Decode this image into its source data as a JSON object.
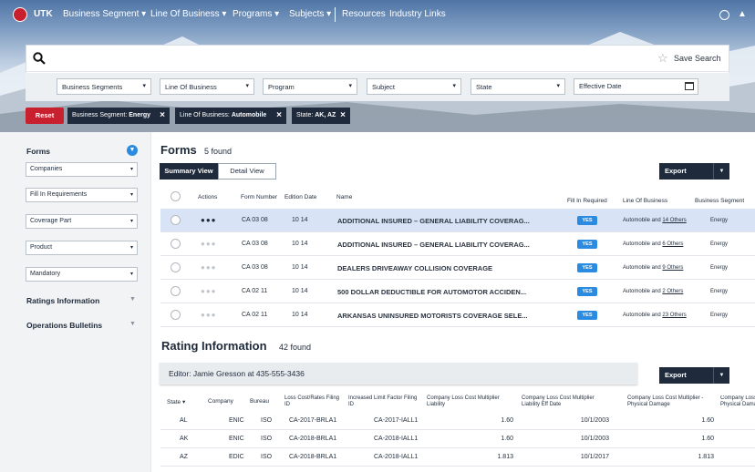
{
  "nav": {
    "brand": "UTK",
    "items": [
      "Business Segment",
      "Line Of Business",
      "Programs",
      "Subjects",
      "Resources",
      "Industry Links"
    ]
  },
  "search": {
    "placeholder": "",
    "save_label": "Save Search"
  },
  "filters": {
    "selects": [
      "Business Segments",
      "Line Of Business",
      "Program",
      "Subject",
      "State"
    ],
    "date_label": "Effective Date"
  },
  "active_filters": {
    "reset_label": "Reset",
    "chips": [
      {
        "label": "Business Segment: ",
        "value": "Energy"
      },
      {
        "label": "Line Of Business: ",
        "value": "Automobile"
      },
      {
        "label": "State: ",
        "value": "AK, AZ"
      }
    ]
  },
  "sidebar": {
    "forms_title": "Forms",
    "selects": [
      "Companies",
      "Fill In Requirements",
      "Coverage Part",
      "Product",
      "Mandatory"
    ],
    "sections": [
      "Ratings Information",
      "Operations Bulletins"
    ]
  },
  "forms": {
    "title": "Forms",
    "count": "5 found",
    "tabs": [
      "Summary View",
      "Detail View"
    ],
    "export_label": "Export",
    "columns": [
      "Actions",
      "Form Number",
      "Edition Date",
      "Name",
      "Fill In Required",
      "Line Of Business",
      "Business Segment"
    ],
    "rows": [
      {
        "form": "CA 03 08",
        "edition": "10 14",
        "name": "ADDITIONAL INSURED – GENERAL LIABILITY COVERAG...",
        "fill": "YES",
        "lob": "Automobile and ",
        "lob_link": "14 Others",
        "segment": "Energy"
      },
      {
        "form": "CA 03 08",
        "edition": "10 14",
        "name": "ADDITIONAL INSURED – GENERAL LIABILITY COVERAG...",
        "fill": "YES",
        "lob": "Automobile and ",
        "lob_link": "6 Others",
        "segment": "Energy"
      },
      {
        "form": "CA 03 08",
        "edition": "10 14",
        "name": "DEALERS DRIVEAWAY COLLISION COVERAGE",
        "fill": "YES",
        "lob": "Automobile and ",
        "lob_link": "9 Others",
        "segment": "Energy"
      },
      {
        "form": "CA 02 11",
        "edition": "10 14",
        "name": "500 DOLLAR DEDUCTIBLE FOR AUTOMOTOR ACCIDEN...",
        "fill": "YES",
        "lob": "Automobile and ",
        "lob_link": "2 Others",
        "segment": "Energy"
      },
      {
        "form": "CA 02 11",
        "edition": "10 14",
        "name": "ARKANSAS UNINSURED MOTORISTS COVERAGE SELE...",
        "fill": "YES",
        "lob": "Automobile and ",
        "lob_link": "23 Others",
        "segment": "Energy"
      }
    ]
  },
  "rating": {
    "title": "Rating Information",
    "count": "42 found",
    "editor": "Editor: Jamie Gresson at 435-555-3436",
    "export_label": "Export",
    "columns": [
      "State",
      "Company",
      "Bureau",
      "Loss Cost/Rates Filing ID",
      "Increased Limit Factor Filing ID",
      "Company Loss Cost Multiplier Liability",
      "Company Loss Cost Multiplier Liability Eff Date",
      "Company Loss Cost Multiplier - Physical Damage",
      "Company Loss Cost Physical Dama"
    ],
    "rows": [
      {
        "state": "AL",
        "company": "ENIC",
        "bureau": "ISO",
        "lc": "CA-2017-BRLA1",
        "ilf": "CA-2017-IALL1",
        "mult": "1.60",
        "eff": "10/1/2003",
        "pd": "1.60"
      },
      {
        "state": "AK",
        "company": "ENIC",
        "bureau": "ISO",
        "lc": "CA-2018-BRLA1",
        "ilf": "CA-2018-IALL1",
        "mult": "1.60",
        "eff": "10/1/2003",
        "pd": "1.60"
      },
      {
        "state": "AZ",
        "company": "EDIC",
        "bureau": "ISO",
        "lc": "CA-2018-BRLA1",
        "ilf": "CA-2018-IALL1",
        "mult": "1.813",
        "eff": "10/1/2017",
        "pd": "1.813"
      }
    ]
  },
  "colors": {
    "accent": "#c8202f",
    "dark": "#1f2b3d",
    "badge": "#2a8be0",
    "selected_row": "#d8e4f5"
  }
}
